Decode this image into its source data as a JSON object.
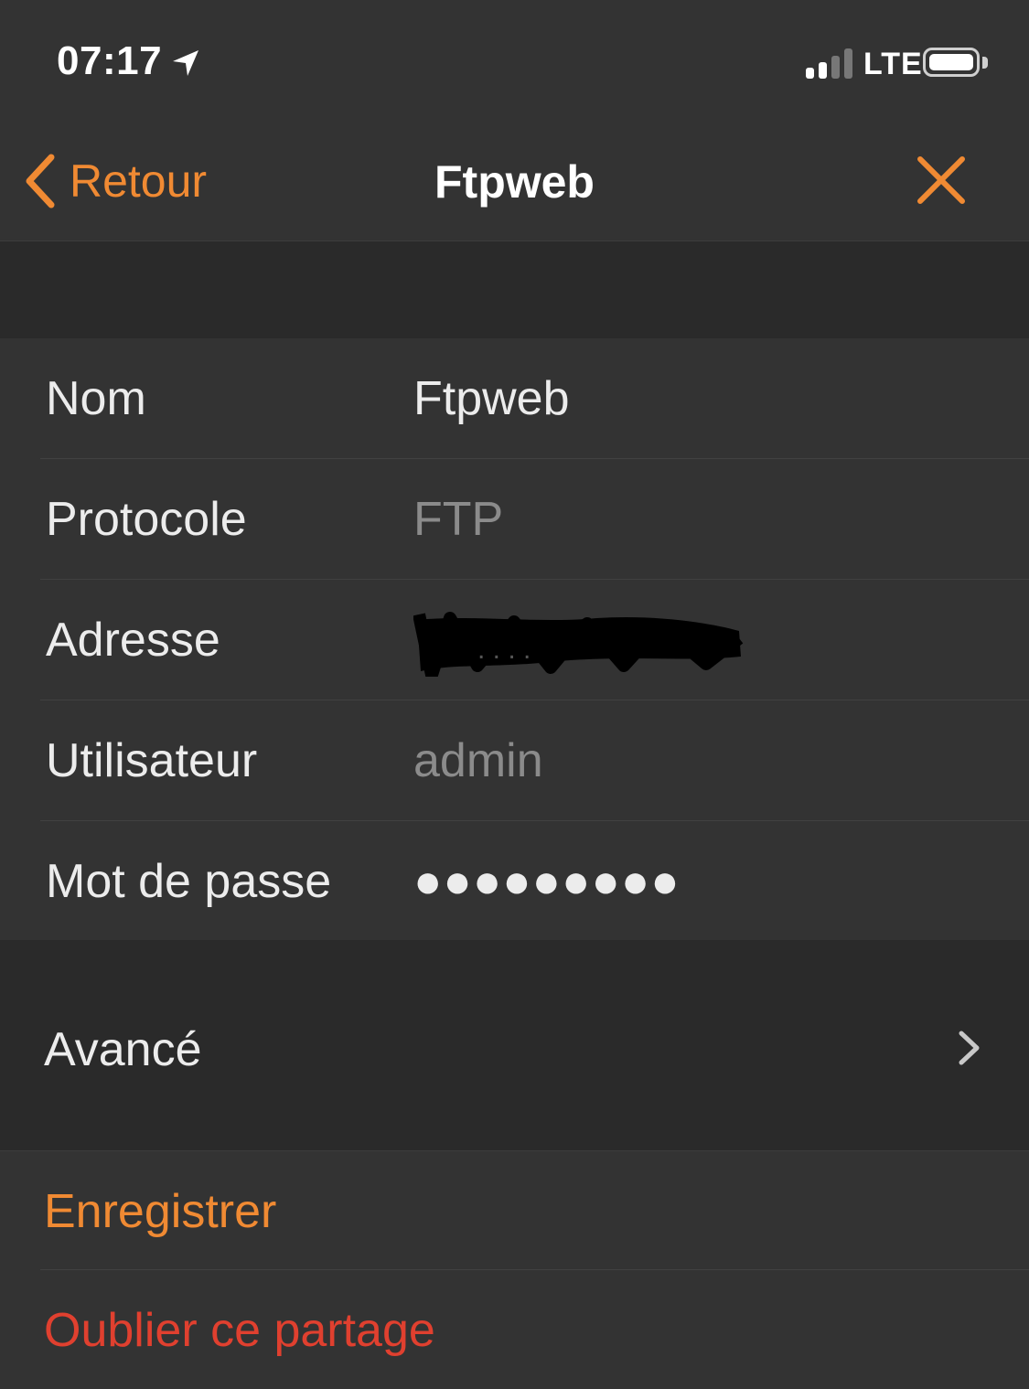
{
  "status_bar": {
    "time": "07:17",
    "network": "LTE",
    "location_icon": "location-arrow-icon",
    "signal_icon": "signal-bars-icon",
    "battery_icon": "battery-icon"
  },
  "nav": {
    "back_label": "Retour",
    "title": "Ftpweb",
    "back_icon": "chevron-left-icon",
    "close_icon": "close-icon"
  },
  "form": {
    "name_label": "Nom",
    "name_value": "Ftpweb",
    "protocol_label": "Protocole",
    "protocol_value": "FTP",
    "address_label": "Adresse",
    "user_label": "Utilisateur",
    "user_value": "admin",
    "password_label": "Mot de passe",
    "password_value": "●●●●●●●●●"
  },
  "advanced": {
    "label": "Avancé",
    "icon": "chevron-right-icon"
  },
  "actions": {
    "save_label": "Enregistrer",
    "forget_label": "Oublier ce partage"
  },
  "colors": {
    "accent": "#f08a33",
    "destructive": "#e0402f",
    "background": "#2a2a2a",
    "cell": "#333333"
  }
}
